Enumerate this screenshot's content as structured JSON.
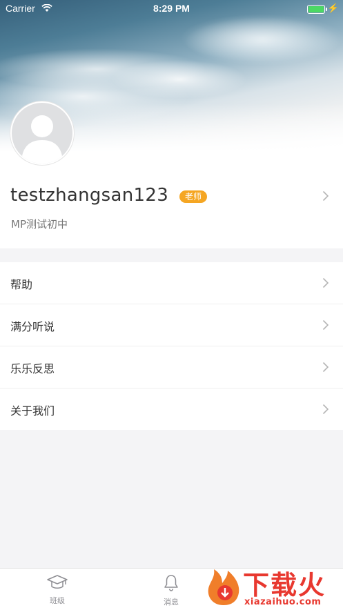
{
  "status_bar": {
    "carrier": "Carrier",
    "time": "8:29 PM",
    "battery_color": "#4cd964"
  },
  "profile": {
    "username": "testzhangsan123",
    "role_badge": "老师",
    "role_badge_color": "#f5a623",
    "school": "MP测试初中",
    "avatar_icon": "default-user-avatar"
  },
  "menu": {
    "items": [
      {
        "label": "帮助"
      },
      {
        "label": "满分听说"
      },
      {
        "label": "乐乐反思"
      },
      {
        "label": "关于我们"
      }
    ]
  },
  "tabbar": {
    "tabs": [
      {
        "label": "班级",
        "icon": "graduation-cap-icon"
      },
      {
        "label": "消息",
        "icon": "bell-icon"
      }
    ]
  },
  "watermark": {
    "text": "下载火",
    "subtext": "xiazaihuo.com",
    "color": "#e8382f"
  }
}
